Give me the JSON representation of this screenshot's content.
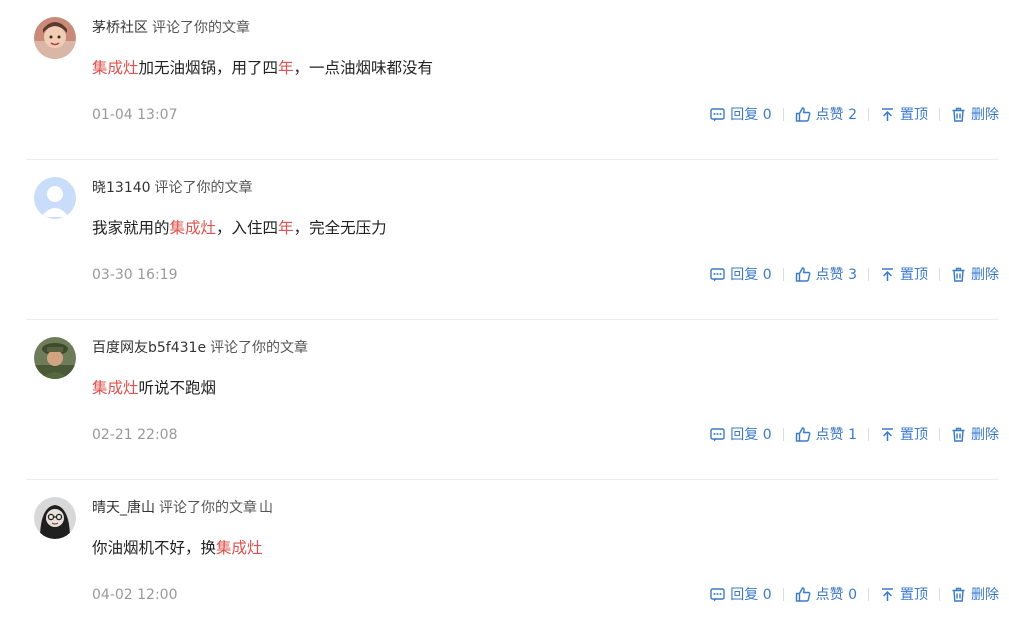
{
  "comments": [
    {
      "author": "茅桥社区",
      "action": "评论了你的文章",
      "extra": "",
      "content": [
        {
          "t": "集成灶",
          "hl": true
        },
        {
          "t": "加无油烟锅，用了四",
          "hl": false
        },
        {
          "t": "年",
          "hl": true
        },
        {
          "t": "，一点油烟味都没有",
          "hl": false
        }
      ],
      "time": "01-04 13:07",
      "reply_label": "回复 0",
      "like_label": "点赞 2",
      "pin_label": "置顶",
      "delete_label": "删除",
      "avatar": "child-photo-avatar"
    },
    {
      "author": "晓13140",
      "action": "评论了你的文章",
      "extra": "",
      "content": [
        {
          "t": "我家就用的",
          "hl": false
        },
        {
          "t": "集成灶",
          "hl": true
        },
        {
          "t": "，入住四",
          "hl": false
        },
        {
          "t": "年",
          "hl": true
        },
        {
          "t": "，完全无压力",
          "hl": false
        }
      ],
      "time": "03-30 16:19",
      "reply_label": "回复 0",
      "like_label": "点赞 3",
      "pin_label": "置顶",
      "delete_label": "删除",
      "avatar": "default-user-avatar"
    },
    {
      "author": "百度网友b5f431e",
      "action": "评论了你的文章",
      "extra": "",
      "content": [
        {
          "t": "集成灶",
          "hl": true
        },
        {
          "t": "听说不跑烟",
          "hl": false
        }
      ],
      "time": "02-21 22:08",
      "reply_label": "回复 0",
      "like_label": "点赞 1",
      "pin_label": "置顶",
      "delete_label": "删除",
      "avatar": "soldier-photo-avatar"
    },
    {
      "author": "晴天_唐山",
      "action": "评论了你的文章",
      "extra": "山",
      "content": [
        {
          "t": "你油烟机不好，换",
          "hl": false
        },
        {
          "t": "集成灶",
          "hl": true
        }
      ],
      "time": "04-02 12:00",
      "reply_label": "回复 0",
      "like_label": "点赞 0",
      "pin_label": "置顶",
      "delete_label": "删除",
      "avatar": "woman-photo-avatar"
    }
  ],
  "colors": {
    "highlight": "#e0524f",
    "action_blue": "#3a79c9",
    "time_gray": "#999999",
    "divider": "#ececec"
  }
}
